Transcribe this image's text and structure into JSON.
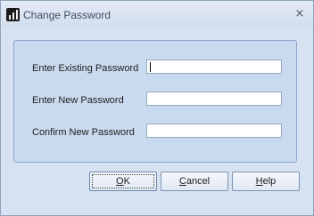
{
  "window": {
    "title": "Change Password",
    "close_glyph": "×",
    "icon": "app-chart-icon"
  },
  "form": {
    "fields": [
      {
        "label": "Enter Existing Password",
        "value": ""
      },
      {
        "label": "Enter New Password",
        "value": ""
      },
      {
        "label": "Confirm New Password",
        "value": ""
      }
    ]
  },
  "buttons": {
    "ok": {
      "accel": "O",
      "rest": "K"
    },
    "cancel": {
      "accel": "C",
      "rest": "ancel"
    },
    "help": {
      "accel": "H",
      "rest": "elp"
    }
  },
  "colors": {
    "titlebar": "#dbe5f2",
    "panel": "#c9d9ee",
    "panel_border": "#8ba6c9"
  }
}
